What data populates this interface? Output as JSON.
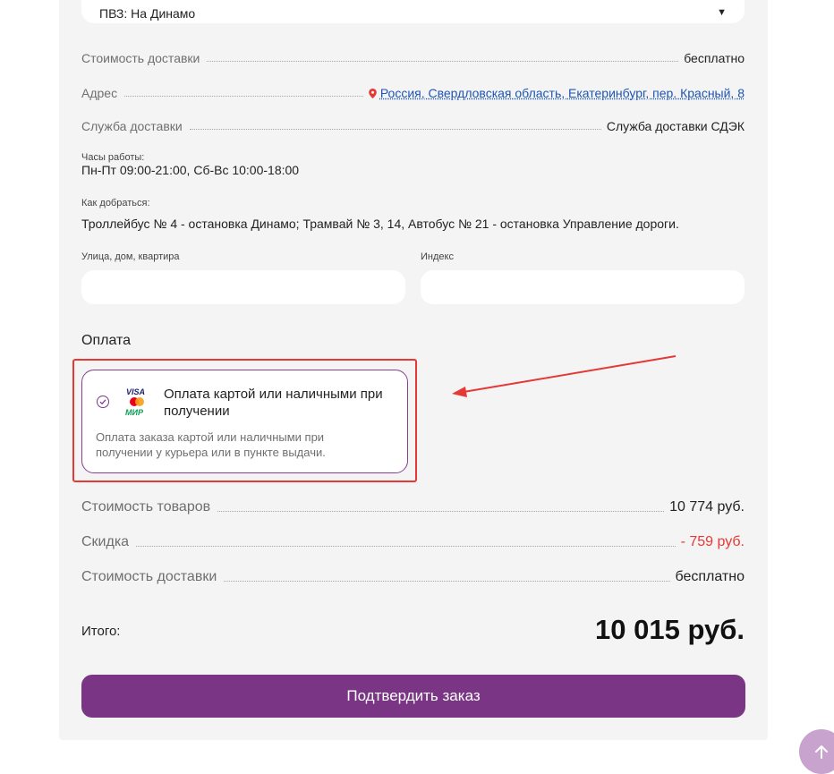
{
  "pickup": {
    "selected": "ПВЗ: На Динамо"
  },
  "delivery": {
    "cost_label": "Стоимость доставки",
    "cost_value": "бесплатно",
    "address_label": "Адрес",
    "address_value": "Россия, Свердловская область, Екатеринбург, пер. Красный, 8",
    "service_label": "Служба доставки",
    "service_value": "Служба доставки СДЭК",
    "hours_label": "Часы работы:",
    "hours_value": "Пн-Пт 09:00-21:00, Сб-Вс 10:00-18:00",
    "directions_label": "Как добраться:",
    "directions_value": "Троллейбус № 4 - остановка Динамо; Трамвай № 3, 14, Автобус № 21 - остановка Управление дороги."
  },
  "form": {
    "street_label": "Улица, дом, квартира",
    "street_value": "",
    "index_label": "Индекс",
    "index_value": ""
  },
  "payment": {
    "section_title": "Оплата",
    "option_title": "Оплата картой или наличными при получении",
    "option_desc": "Оплата заказа картой или наличными при получении у курьера или в пункте выдачи.",
    "logos": {
      "visa": "VISA",
      "mir": "МИР"
    },
    "selected": true
  },
  "summary": {
    "goods_label": "Стоимость товаров",
    "goods_value": "10 774 руб.",
    "discount_label": "Скидка",
    "discount_value": "- 759 руб.",
    "delivery_label": "Стоимость доставки",
    "delivery_value": "бесплатно",
    "total_label": "Итого:",
    "total_value": "10 015 руб."
  },
  "confirm_button": "Подтвердить заказ",
  "colors": {
    "accent": "#7a3585",
    "link": "#1d55b5",
    "discount": "#e53935",
    "annotation": "#e53935"
  },
  "icons": [
    "chevron-down-icon",
    "location-pin-icon",
    "radio-check-icon",
    "visa-logo",
    "mastercard-logo",
    "mir-logo",
    "arrow-up-icon",
    "annotation-arrow"
  ]
}
